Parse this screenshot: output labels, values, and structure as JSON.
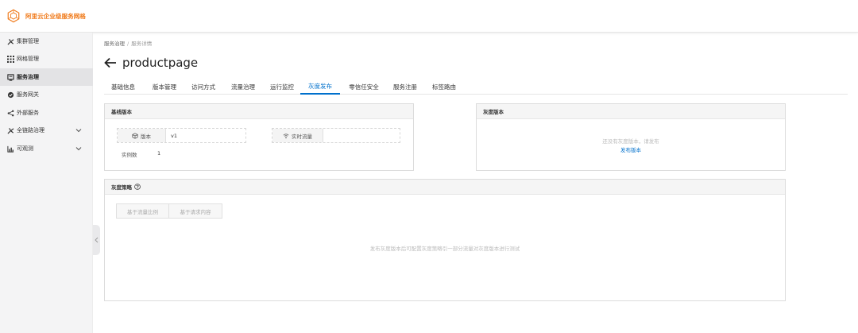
{
  "app": {
    "title": "阿里云企业级服务网格",
    "brand_color": "#f07a1a",
    "accent_color": "#0070cc"
  },
  "sidebar": {
    "items": [
      {
        "label": "集群管理",
        "icon": "cluster-icon"
      },
      {
        "label": "网格管理",
        "icon": "grid-icon"
      },
      {
        "label": "服务治理",
        "icon": "service-icon",
        "active": true
      },
      {
        "label": "服务网关",
        "icon": "gateway-icon"
      },
      {
        "label": "外部服务",
        "icon": "share-icon"
      },
      {
        "label": "全链路治理",
        "icon": "trace-icon",
        "expandable": true
      },
      {
        "label": "可观测",
        "icon": "chart-icon",
        "expandable": true
      }
    ]
  },
  "breadcrumb": {
    "root": "服务治理",
    "separator": "/",
    "current": "服务详情"
  },
  "page": {
    "title": "productpage"
  },
  "tabs": [
    {
      "label": "基础信息"
    },
    {
      "label": "版本管理"
    },
    {
      "label": "访问方式"
    },
    {
      "label": "流量治理"
    },
    {
      "label": "运行监控"
    },
    {
      "label": "灰度发布",
      "active": true
    },
    {
      "label": "零信任安全"
    },
    {
      "label": "服务注册"
    },
    {
      "label": "标签路由"
    }
  ],
  "baseline": {
    "title": "基线版本",
    "version_label": "版本",
    "version_value": "v1",
    "traffic_label": "实时流量",
    "traffic_value": "",
    "instances_label": "实例数",
    "instances_value": "1"
  },
  "canary": {
    "title": "灰度版本",
    "empty_text": "还没有灰度版本，请发布",
    "publish_link": "发布版本"
  },
  "strategy": {
    "title": "灰度策略",
    "options": [
      "基于流量比例",
      "基于请求内容"
    ],
    "empty_text": "发布灰度版本后可配置灰度策略引一部分流量对灰度版本进行测试"
  }
}
